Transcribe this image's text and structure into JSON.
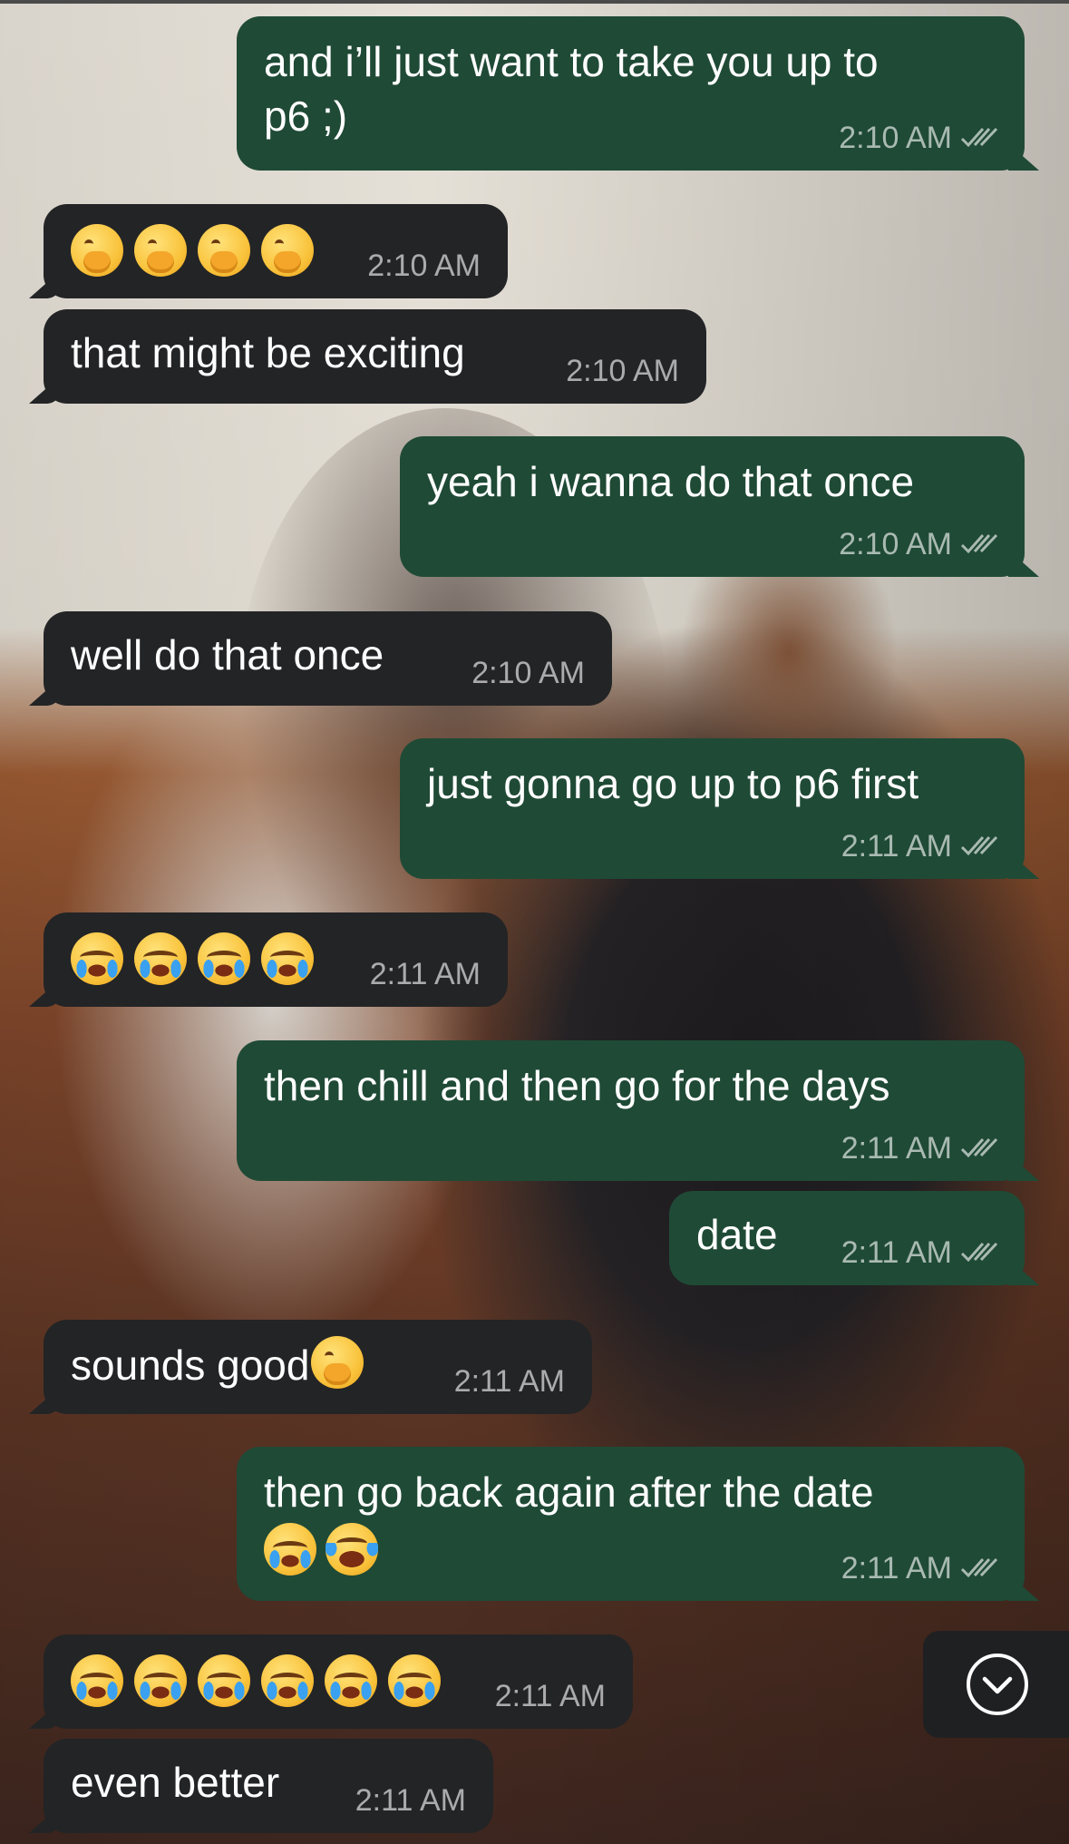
{
  "messages": [
    {
      "side": "out",
      "text": "and i’ll just want to take you up to",
      "text2": "p6 ;)",
      "time": "2:10 AM",
      "read": true
    },
    {
      "side": "in",
      "emoji": [
        "face-with-hand-over-mouth",
        "face-with-hand-over-mouth",
        "face-with-hand-over-mouth",
        "face-with-hand-over-mouth"
      ],
      "time": "2:10 AM"
    },
    {
      "side": "in",
      "text": "that might be exciting",
      "time": "2:10 AM"
    },
    {
      "side": "out",
      "text": "yeah i wanna do that once",
      "time": "2:10 AM",
      "read": true
    },
    {
      "side": "in",
      "text": "well do that once",
      "time": "2:10 AM"
    },
    {
      "side": "out",
      "text": "just gonna go up to p6 first",
      "time": "2:11 AM",
      "read": true
    },
    {
      "side": "in",
      "emoji": [
        "loudly-crying-face",
        "loudly-crying-face",
        "loudly-crying-face",
        "loudly-crying-face"
      ],
      "time": "2:11 AM"
    },
    {
      "side": "out",
      "text": "then chill and then go for the days",
      "time": "2:11 AM",
      "read": true
    },
    {
      "side": "out",
      "text": "date",
      "time": "2:11 AM",
      "read": true
    },
    {
      "side": "in",
      "text": "sounds good",
      "emoji": [
        "face-with-hand-over-mouth"
      ],
      "time": "2:11 AM"
    },
    {
      "side": "out",
      "text": "then go back again after the date",
      "emoji": [
        "loudly-crying-face",
        "face-with-tears-of-joy"
      ],
      "time": "2:11 AM",
      "read": true
    },
    {
      "side": "in",
      "emoji": [
        "loudly-crying-face",
        "loudly-crying-face",
        "loudly-crying-face",
        "loudly-crying-face",
        "loudly-crying-face",
        "loudly-crying-face"
      ],
      "time": "2:11 AM"
    },
    {
      "side": "in",
      "text": "even better",
      "time": "2:11 AM"
    }
  ],
  "icons": {
    "read_receipt": "double-check-icon",
    "scroll_down": "chevron-down-circle-icon"
  },
  "colors": {
    "incoming_bubble": "#232426",
    "outgoing_bubble": "#1f4a36",
    "text": "#ffffff",
    "meta": "#a9b0ac"
  }
}
